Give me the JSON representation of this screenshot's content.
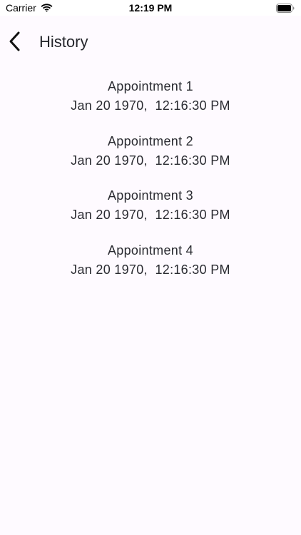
{
  "status_bar": {
    "carrier": "Carrier",
    "time": "12:19 PM",
    "icons": [
      "wifi-icon",
      "battery-icon"
    ]
  },
  "nav": {
    "title": "History",
    "back_icon": "chevron-left-icon"
  },
  "appointments": [
    {
      "title": "Appointment 1",
      "date": "Jan 20 1970,  12:16:30 PM"
    },
    {
      "title": "Appointment 2",
      "date": "Jan 20 1970,  12:16:30 PM"
    },
    {
      "title": "Appointment 3",
      "date": "Jan 20 1970,  12:16:30 PM"
    },
    {
      "title": "Appointment 4",
      "date": "Jan 20 1970,  12:16:30 PM"
    }
  ],
  "colors": {
    "background": "#fefaff",
    "text": "#2a2b31",
    "status_bar": "#ffffff"
  }
}
